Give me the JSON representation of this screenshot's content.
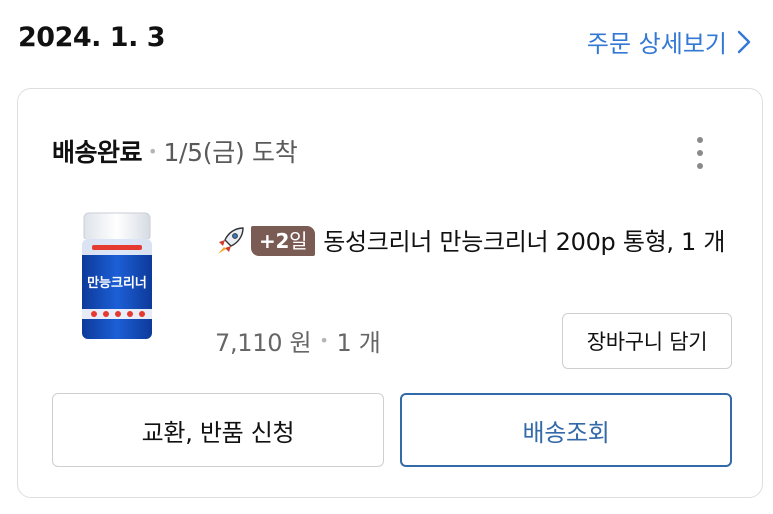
{
  "order": {
    "date": "2024. 1. 3",
    "detail_link_label": "주문 상세보기"
  },
  "delivery": {
    "status": "배송완료",
    "arrival": "1/5(금) 도착"
  },
  "product": {
    "badge_days": "+2",
    "badge_suffix": "일",
    "name": "동성크리너 만능크리너 200p 통형, 1 개",
    "price": "7,110 원",
    "quantity": "1 개",
    "image_text": "만능크리너"
  },
  "buttons": {
    "add_to_cart": "장바구니 담기",
    "exchange_return": "교환, 반품 신청",
    "track_delivery": "배송조회"
  },
  "icons": {
    "detail_chevron": "chevron-right-icon",
    "more": "kebab-menu-icon",
    "rocket": "rocket-icon"
  },
  "colors": {
    "accent_blue": "#3478d6",
    "tracking_blue": "#346aa8",
    "badge_brown": "#7a5c54"
  }
}
